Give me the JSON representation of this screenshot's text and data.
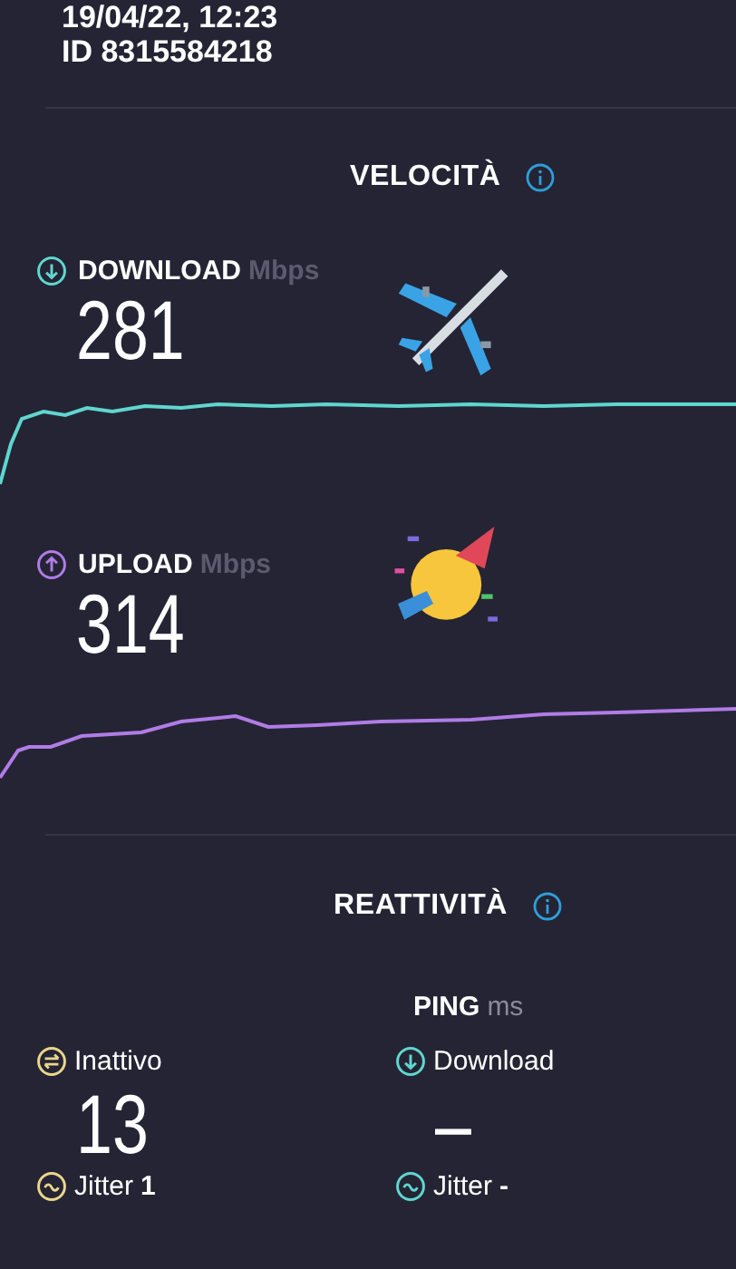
{
  "header": {
    "date": "19/04/22, 12:23",
    "id": "ID 8315584218"
  },
  "speed": {
    "title": "VELOCITÀ",
    "tests": [
      {
        "kind": "download",
        "label": "DOWNLOAD",
        "unit": "Mbps",
        "value": "281",
        "color": "#5fd6d0"
      },
      {
        "kind": "upload",
        "label": "UPLOAD",
        "unit": "Mbps",
        "value": "314",
        "color": "#b07ce6"
      }
    ]
  },
  "responsiveness": {
    "title": "REATTIVITÀ",
    "ping": {
      "label": "PING",
      "unit": "ms"
    },
    "columns": [
      {
        "kind": "idle",
        "label": "Inattivo",
        "value": "13",
        "jitter_label": "Jitter",
        "jitter_value": "1",
        "color": "#e9d68c"
      },
      {
        "kind": "download",
        "label": "Download",
        "value": "–",
        "jitter_label": "Jitter",
        "jitter_value": "-",
        "color": "#5fd6d0"
      }
    ]
  }
}
